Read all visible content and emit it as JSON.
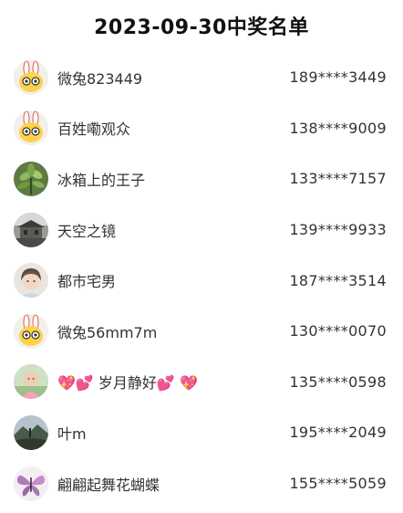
{
  "title": "2023-09-30中奖名单",
  "winners": [
    {
      "name": "微兔823449",
      "phone": "189****3449",
      "avatar": "rabbit-avatar"
    },
    {
      "name": "百姓嘞观众",
      "phone": "138****9009",
      "avatar": "rabbit-avatar"
    },
    {
      "name": "冰箱上的王子",
      "phone": "133****7157",
      "avatar": "plant-avatar"
    },
    {
      "name": "天空之镜",
      "phone": "139****9933",
      "avatar": "building-avatar"
    },
    {
      "name": "都市宅男",
      "phone": "187****3514",
      "avatar": "person-avatar"
    },
    {
      "name": "微兔56mm7m",
      "phone": "130****0070",
      "avatar": "rabbit-avatar"
    },
    {
      "name": "💖💕 岁月静好💕 💖",
      "phone": "135****0598",
      "avatar": "child-avatar"
    },
    {
      "name": "叶m",
      "phone": "195****2049",
      "avatar": "landscape-avatar"
    },
    {
      "name": "翩翩起舞花蝴蝶",
      "phone": "155****5059",
      "avatar": "butterfly-avatar"
    }
  ]
}
